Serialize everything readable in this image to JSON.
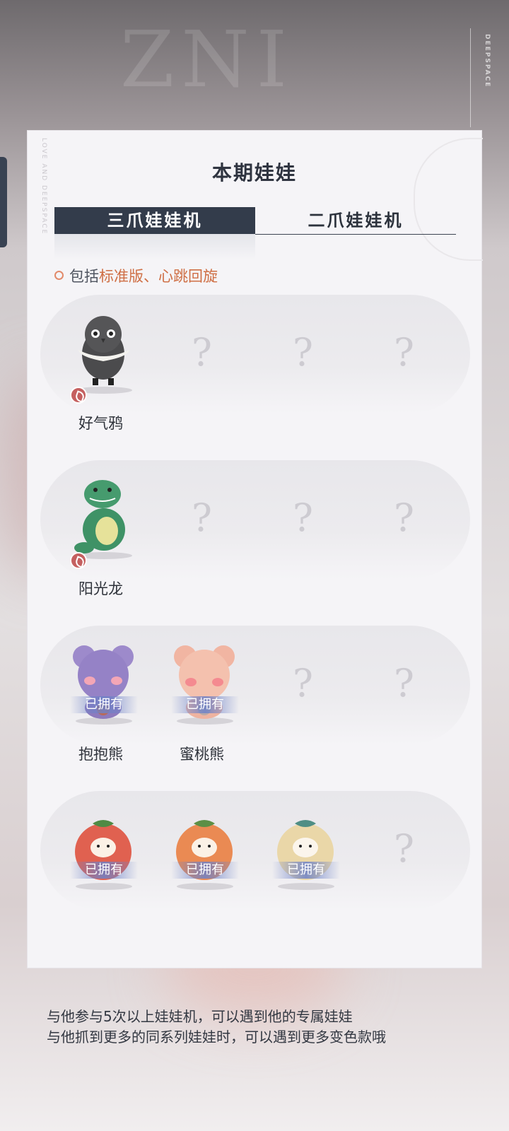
{
  "brand": {
    "vertical_text": "DEEPSPACE"
  },
  "panel": {
    "title": "本期娃娃",
    "tabs": [
      {
        "label": "三爪娃娃机",
        "active": true
      },
      {
        "label": "二爪娃娃机",
        "active": false
      }
    ],
    "include_prefix": "包括",
    "include_highlight": "标准版、心跳回旋",
    "rows": [
      {
        "dolls": [
          {
            "name": "好气鸦",
            "known": true,
            "owned": false,
            "badge": true,
            "kind": "crow"
          },
          {
            "name": "",
            "known": false,
            "q": "?"
          },
          {
            "name": "",
            "known": false,
            "q": "?"
          },
          {
            "name": "",
            "known": false,
            "q": "?"
          }
        ]
      },
      {
        "dolls": [
          {
            "name": "阳光龙",
            "known": true,
            "owned": false,
            "badge": true,
            "kind": "dino"
          },
          {
            "name": "",
            "known": false,
            "q": "?"
          },
          {
            "name": "",
            "known": false,
            "q": "?"
          },
          {
            "name": "",
            "known": false,
            "q": "?"
          }
        ]
      },
      {
        "dolls": [
          {
            "name": "抱抱熊",
            "known": true,
            "owned": true,
            "owned_label": "已拥有",
            "kind": "bear-purple"
          },
          {
            "name": "蜜桃熊",
            "known": true,
            "owned": true,
            "owned_label": "已拥有",
            "kind": "bear-pink"
          },
          {
            "name": "",
            "known": false,
            "q": "?"
          },
          {
            "name": "",
            "known": false,
            "q": "?"
          }
        ]
      },
      {
        "dolls": [
          {
            "name": "",
            "known": true,
            "owned": true,
            "owned_label": "已拥有",
            "kind": "fruit-red"
          },
          {
            "name": "",
            "known": true,
            "owned": true,
            "owned_label": "已拥有",
            "kind": "fruit-orange"
          },
          {
            "name": "",
            "known": true,
            "owned": true,
            "owned_label": "已拥有",
            "kind": "fruit-cream"
          },
          {
            "name": "",
            "known": false,
            "q": "?"
          }
        ]
      }
    ]
  },
  "footer": {
    "line1": "与他参与5次以上娃娃机，可以遇到他的专属娃娃",
    "line2": "与他抓到更多的同系列娃娃时，可以遇到更多变色款哦"
  },
  "colors": {
    "tab_active_bg": "#333c4b",
    "accent": "#cf6f45",
    "owned_band": "#6e82c8"
  }
}
